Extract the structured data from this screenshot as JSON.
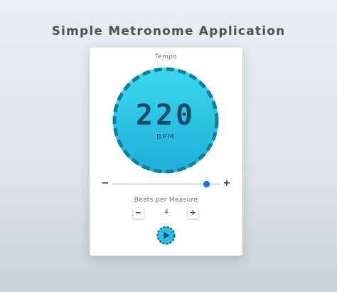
{
  "header": {
    "title": "Simple Metronome Application"
  },
  "metronome": {
    "tempo_label": "Tempo",
    "bpm_value": "220",
    "bpm_unit": "BPM",
    "tempo_slider": {
      "minus_label": "−",
      "plus_label": "+",
      "fraction": 0.87
    },
    "beats": {
      "label": "Beats per Measure",
      "value": "4",
      "minus_label": "−",
      "plus_label": "+"
    },
    "play_button": {
      "icon": "play-icon"
    }
  },
  "colors": {
    "dial_fill_top": "#3ad9ee",
    "dial_fill_bottom": "#1faed8",
    "dial_dash": "#0d7f9a",
    "text_dark": "#1b4a6a",
    "slider_thumb": "#1e6fe8",
    "play_fill": "#2bbde6",
    "play_icon": "#0b4e7a"
  }
}
